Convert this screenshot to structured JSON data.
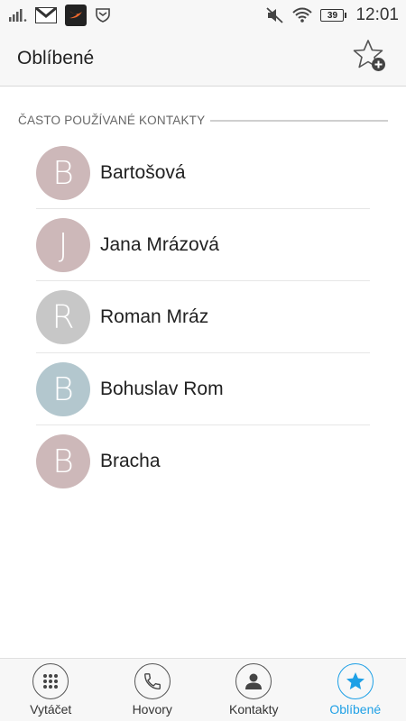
{
  "status_bar": {
    "time": "12:01",
    "battery_level": "39",
    "icons_left": [
      "signal-bars-icon",
      "gmail-icon",
      "swift-app-icon",
      "shield-app-icon"
    ],
    "icons_right": [
      "muted-speaker-icon",
      "wifi-icon",
      "battery-icon"
    ]
  },
  "app_bar": {
    "title": "Oblíbené",
    "action_icon": "star-add-icon"
  },
  "section": {
    "title": "ČASTO POUŽÍVANÉ KONTAKTY"
  },
  "contacts": [
    {
      "initial": "B",
      "name": "Bartošová",
      "color": "#cdb8b9"
    },
    {
      "initial": "J",
      "name": "Jana Mrázová",
      "color": "#cdb8b9"
    },
    {
      "initial": "R",
      "name": "Roman Mráz",
      "color": "#c7c7c7"
    },
    {
      "initial": "B",
      "name": "Bohuslav Rom",
      "color": "#b3c7ce"
    },
    {
      "initial": "B",
      "name": "Bracha",
      "color": "#cdb8b9"
    }
  ],
  "bottom_nav": {
    "tabs": [
      {
        "label": "Vytáčet",
        "icon": "dialpad-icon",
        "active": false
      },
      {
        "label": "Hovory",
        "icon": "phone-icon",
        "active": false
      },
      {
        "label": "Kontakty",
        "icon": "person-icon",
        "active": false
      },
      {
        "label": "Oblíbené",
        "icon": "star-icon",
        "active": true
      }
    ]
  },
  "colors": {
    "accent": "#1ea0e6",
    "background": "#ffffff",
    "bar_background": "#f7f7f7"
  }
}
